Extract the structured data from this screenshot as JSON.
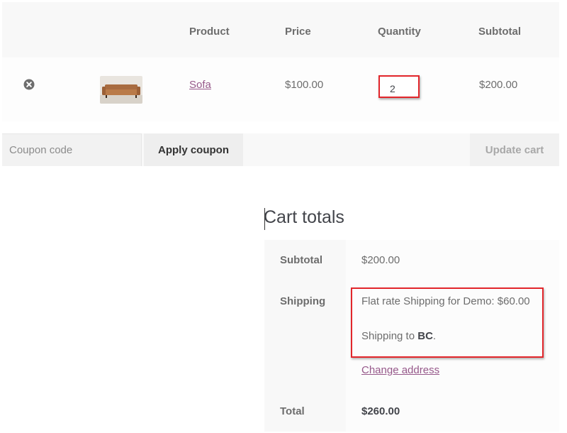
{
  "cart_table": {
    "headers": {
      "product": "Product",
      "price": "Price",
      "quantity": "Quantity",
      "subtotal": "Subtotal"
    },
    "items": [
      {
        "name": "Sofa",
        "price": "$100.00",
        "quantity": "2",
        "subtotal": "$200.00",
        "remove_icon": "circle-x-icon",
        "thumbnail": "sofa-product-image"
      }
    ]
  },
  "actions": {
    "coupon_placeholder": "Coupon code",
    "apply_coupon_label": "Apply coupon",
    "update_cart_label": "Update cart"
  },
  "totals": {
    "title": "Cart totals",
    "subtotal_label": "Subtotal",
    "subtotal_value": "$200.00",
    "shipping_label": "Shipping",
    "shipping_method": "Flat rate Shipping for Demo: $60.00",
    "shipping_to_prefix": "Shipping to ",
    "shipping_to_region": "BC",
    "shipping_to_suffix": ".",
    "change_address_label": "Change address",
    "total_label": "Total",
    "total_value": "$260.00"
  },
  "colors": {
    "link": "#96588a",
    "highlight": "#e2262b",
    "text": "#6d6d6d"
  }
}
